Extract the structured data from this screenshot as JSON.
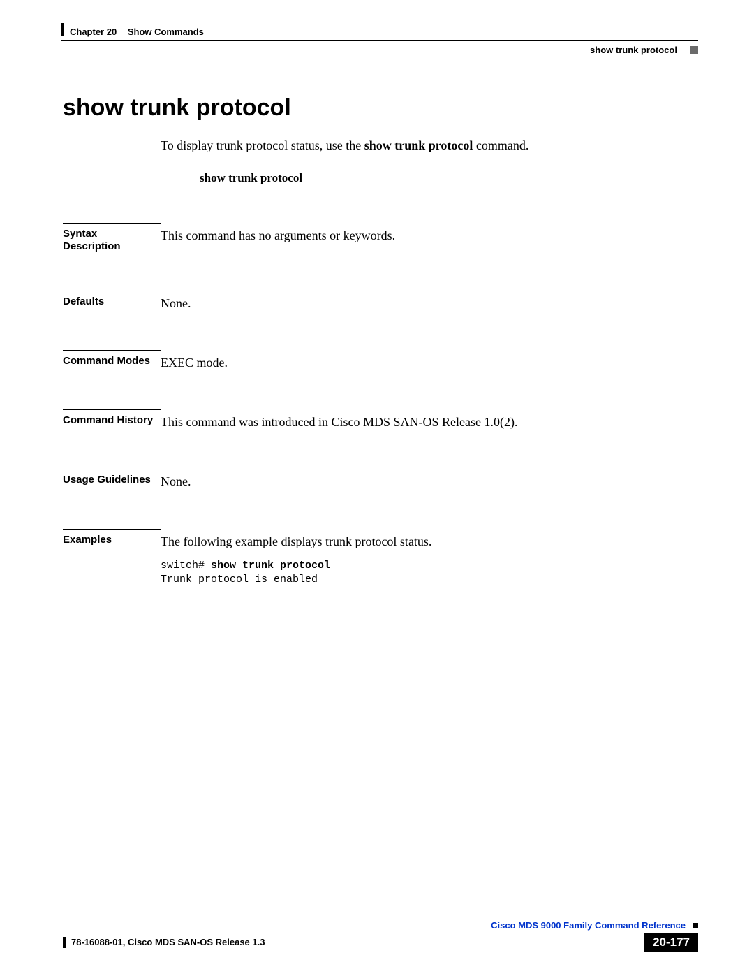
{
  "header": {
    "chapter_num": "Chapter 20",
    "chapter_name": "Show Commands",
    "breadcrumb": "show trunk protocol"
  },
  "title": "show trunk protocol",
  "intro_pre": "To display trunk protocol status, use the ",
  "intro_bold": "show trunk protocol",
  "intro_post": " command.",
  "syntax_cmd": "show trunk protocol",
  "sections": {
    "syntax_desc": {
      "label": "Syntax Description",
      "body": "This command has no arguments or keywords."
    },
    "defaults": {
      "label": "Defaults",
      "body": "None."
    },
    "cmd_modes": {
      "label": "Command Modes",
      "body": "EXEC mode."
    },
    "cmd_history": {
      "label": "Command History",
      "body": "This command was introduced in Cisco MDS SAN-OS Release 1.0(2)."
    },
    "usage": {
      "label": "Usage Guidelines",
      "body": "None."
    },
    "examples": {
      "label": "Examples",
      "body": "The following example displays trunk protocol status."
    }
  },
  "example_code": {
    "prompt": "switch# ",
    "cmd": "show trunk protocol",
    "output": "Trunk protocol is enabled"
  },
  "footer": {
    "doc_title": "Cisco MDS 9000 Family Command Reference",
    "doc_id": "78-16088-01, Cisco MDS SAN-OS Release 1.3",
    "page_num": "20-177"
  }
}
